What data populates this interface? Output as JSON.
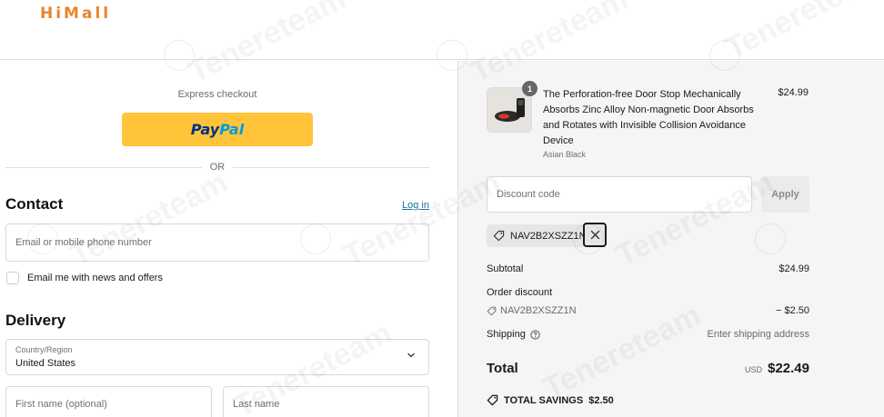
{
  "header": {
    "logo": "HiMall"
  },
  "checkout": {
    "express_label": "Express checkout",
    "paypal": {
      "pay": "Pay",
      "pal": "Pal"
    },
    "or_label": "OR",
    "contact": {
      "title": "Contact",
      "login_link": "Log in",
      "email_placeholder": "Email or mobile phone number",
      "newsletter_label": "Email me with news and offers",
      "newsletter_checked": false
    },
    "delivery": {
      "title": "Delivery",
      "country_label": "Country/Region",
      "country_value": "United States",
      "first_name_placeholder": "First name (optional)",
      "last_name_placeholder": "Last name"
    }
  },
  "summary": {
    "item": {
      "quantity": "1",
      "title": "The Perforation-free Door Stop Mechanically Absorbs Zinc Alloy Non-magnetic Door Absorbs and Rotates with Invisible Collision Avoidance Device",
      "variant": "Asian Black",
      "price": "$24.99"
    },
    "discount_placeholder": "Discount code",
    "apply_label": "Apply",
    "applied_code": "NAV2B2XSZZ1N",
    "subtotal_label": "Subtotal",
    "subtotal_value": "$24.99",
    "order_discount_label": "Order discount",
    "order_discount_code": "NAV2B2XSZZ1N",
    "order_discount_value": "− $2.50",
    "shipping_label": "Shipping",
    "shipping_value": "Enter shipping address",
    "total_label": "Total",
    "total_currency": "USD",
    "total_value": "$22.49",
    "savings_label": "TOTAL SAVINGS",
    "savings_value": "$2.50"
  },
  "watermark": {
    "text": "Tenereteam"
  },
  "colors": {
    "brand": "#e8862a",
    "paypal_yellow": "#ffc439",
    "link": "#1773b0"
  }
}
